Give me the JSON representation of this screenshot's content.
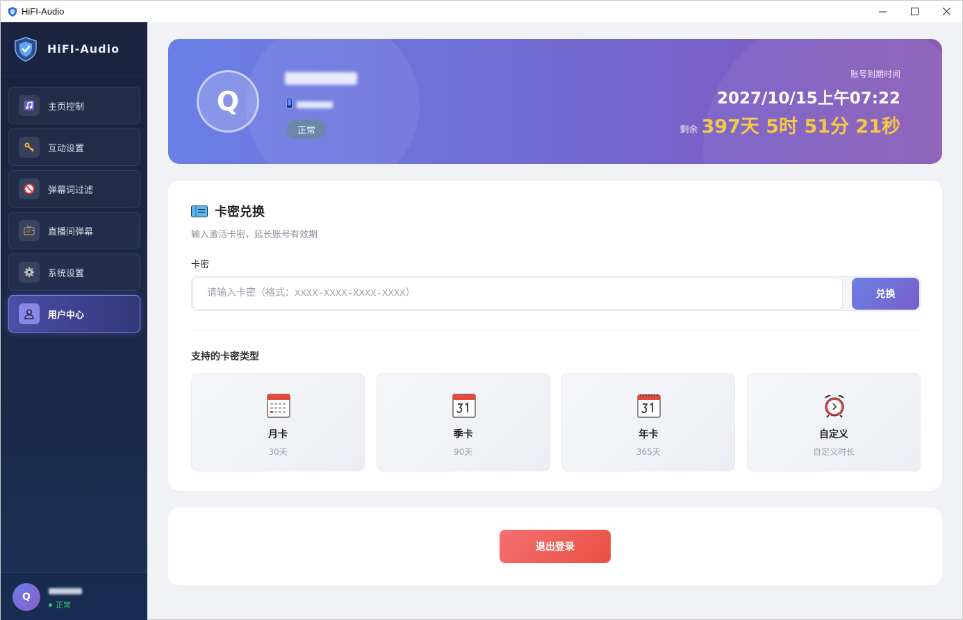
{
  "window": {
    "title": "HiFI-Audio",
    "minimize": "—",
    "maximize": "☐",
    "close": "✕"
  },
  "brand": {
    "name": "HiFI-Audio"
  },
  "sidebar": {
    "items": [
      {
        "label": "主页控制",
        "icon": "music-note-icon",
        "active": false
      },
      {
        "label": "互动设置",
        "icon": "key-icon",
        "active": false
      },
      {
        "label": "弹幕词过滤",
        "icon": "no-entry-icon",
        "active": false
      },
      {
        "label": "直播间弹幕",
        "icon": "tv-icon",
        "active": false
      },
      {
        "label": "系统设置",
        "icon": "gear-icon",
        "active": false
      },
      {
        "label": "用户中心",
        "icon": "user-icon",
        "active": true
      }
    ],
    "user": {
      "avatar": "Q",
      "status": "正常"
    }
  },
  "hero": {
    "avatar": "Q",
    "status": "正常",
    "expire_label": "账号到期时间",
    "expire_time": "2027/10/15上午07:22",
    "remaining_label": "剩余",
    "remaining_value": "397天 5时 51分 21秒"
  },
  "redeem": {
    "title": "卡密兑换",
    "subtitle": "输入激活卡密，延长账号有效期",
    "field_label": "卡密",
    "input_value": "",
    "input_placeholder": "请输入卡密（格式：XXXX-XXXX-XXXX-XXXX）",
    "button_label": "兑换",
    "types_title": "支持的卡密类型",
    "types": [
      {
        "name": "月卡",
        "desc": "30天",
        "icon": "calendar-icon"
      },
      {
        "name": "季卡",
        "desc": "90天",
        "icon": "calendar-31-icon"
      },
      {
        "name": "年卡",
        "desc": "365天",
        "icon": "spiral-calendar-icon"
      },
      {
        "name": "自定义",
        "desc": "自定义时长",
        "icon": "alarm-clock-icon"
      }
    ]
  },
  "logout": {
    "label": "退出登录"
  },
  "colors": {
    "accent": "#6a80e6",
    "accent2": "#7a5ec8",
    "gold": "#f6c945",
    "danger": "#ea4f44",
    "success": "#2ecc71"
  }
}
